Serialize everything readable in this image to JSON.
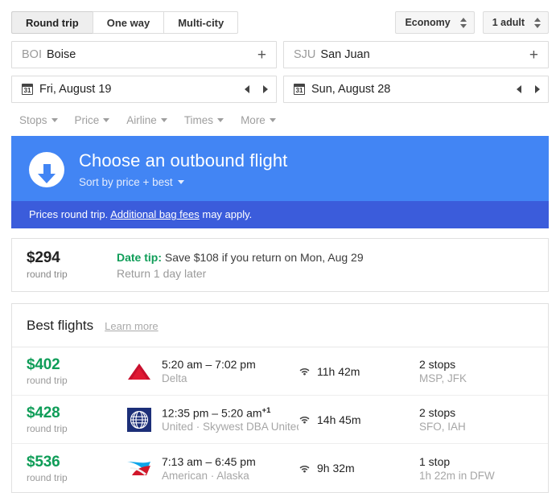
{
  "trip_tabs": [
    {
      "label": "Round trip",
      "active": true
    },
    {
      "label": "One way",
      "active": false
    },
    {
      "label": "Multi-city",
      "active": false
    }
  ],
  "cabin": {
    "label": "Economy"
  },
  "passengers": {
    "label": "1 adult"
  },
  "origin": {
    "code": "BOI",
    "city": "Boise",
    "add_icon": "+"
  },
  "destination": {
    "code": "SJU",
    "city": "San Juan",
    "add_icon": "+"
  },
  "depart_date": {
    "value": "Fri, August 19",
    "calendar_icon": "31"
  },
  "return_date": {
    "value": "Sun, August 28",
    "calendar_icon": "31"
  },
  "filters": [
    {
      "label": "Stops"
    },
    {
      "label": "Price"
    },
    {
      "label": "Airline"
    },
    {
      "label": "Times"
    },
    {
      "label": "More"
    }
  ],
  "banner": {
    "title": "Choose an outbound flight",
    "sort_label": "Sort by price + best",
    "icon": "download-arrow-icon",
    "bg_color": "#4285f4",
    "bag_prefix": "Prices round trip. ",
    "bag_link": "Additional bag fees",
    "bag_suffix": " may apply.",
    "bag_bg_color": "#3b5cdb"
  },
  "date_tip": {
    "price": "$294",
    "price_sub": "round trip",
    "label": "Date tip:",
    "label_color": "#0f9d58",
    "message": " Save $108 if you return on Mon, Aug 29",
    "detail": "Return 1 day later"
  },
  "results": {
    "title": "Best flights",
    "learn_more": "Learn more",
    "price_color": "#0f9d58",
    "flights": [
      {
        "price": "$402",
        "price_sub": "round trip",
        "logo": "delta-logo",
        "times": "5:20 am – 7:02 pm",
        "day_offset": "",
        "airline": "Delta",
        "wifi_icon": "wifi-icon",
        "duration": "11h 42m",
        "stops": "2 stops",
        "stop_detail": "MSP, JFK"
      },
      {
        "price": "$428",
        "price_sub": "round trip",
        "logo": "united-logo",
        "times": "12:35 pm – 5:20 am",
        "day_offset": "+1",
        "airline": "United · Skywest DBA United Exp",
        "wifi_icon": "wifi-icon",
        "duration": "14h 45m",
        "stops": "2 stops",
        "stop_detail": "SFO, IAH"
      },
      {
        "price": "$536",
        "price_sub": "round trip",
        "logo": "american-logo",
        "times": "7:13 am – 6:45 pm",
        "day_offset": "",
        "airline": "American · Alaska",
        "wifi_icon": "wifi-icon",
        "duration": "9h 32m",
        "stops": "1 stop",
        "stop_detail": "1h 22m in DFW"
      }
    ]
  }
}
